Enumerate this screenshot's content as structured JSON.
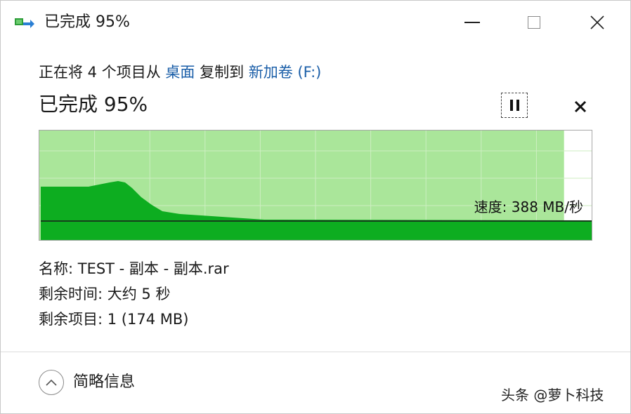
{
  "titlebar": {
    "title": "已完成 95%",
    "icon": "copy-transfer-icon"
  },
  "copy_line": {
    "prefix": "正在将 4 个项目从 ",
    "source": "桌面",
    "middle": " 复制到 ",
    "destination": "新加卷 (F:)"
  },
  "progress": {
    "title": "已完成 95%",
    "percent": 95
  },
  "graph": {
    "speed_label": "速度: 388 MB/秒",
    "fill_color": "#0dad20",
    "progress_color": "#aae69a",
    "grid_color": "#cdeec2"
  },
  "details": {
    "name": "名称: TEST - 副本 - 副本.rar",
    "time_remaining": "剩余时间: 大约 5 秒",
    "items_remaining": "剩余项目: 1 (174 MB)"
  },
  "footer": {
    "toggle_label": "简略信息"
  },
  "watermark": {
    "text": "头条 @萝卜科技"
  }
}
